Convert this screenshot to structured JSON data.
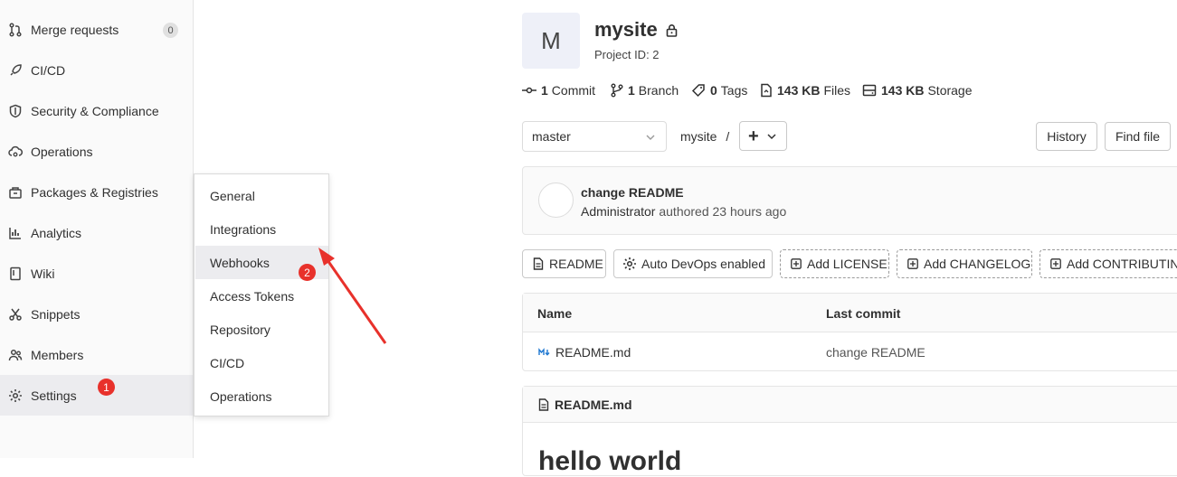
{
  "sidebar": {
    "items": [
      {
        "label": "Merge requests",
        "icon": "merge-request-icon",
        "badge": "0"
      },
      {
        "label": "CI/CD",
        "icon": "rocket-icon"
      },
      {
        "label": "Security & Compliance",
        "icon": "shield-icon"
      },
      {
        "label": "Operations",
        "icon": "cloud-gear-icon"
      },
      {
        "label": "Packages & Registries",
        "icon": "package-icon"
      },
      {
        "label": "Analytics",
        "icon": "chart-icon"
      },
      {
        "label": "Wiki",
        "icon": "book-icon"
      },
      {
        "label": "Snippets",
        "icon": "scissors-icon"
      },
      {
        "label": "Members",
        "icon": "users-icon"
      },
      {
        "label": "Settings",
        "icon": "gear-icon"
      }
    ],
    "step_marker": "1"
  },
  "flyout": {
    "items": [
      "General",
      "Integrations",
      "Webhooks",
      "Access Tokens",
      "Repository",
      "CI/CD",
      "Operations"
    ],
    "step_marker": "2"
  },
  "project": {
    "avatar_letter": "M",
    "name": "mysite",
    "id_label": "Project ID: 2"
  },
  "stats": [
    {
      "value": "1",
      "label": "Commit",
      "icon": "commit-icon"
    },
    {
      "value": "1",
      "label": "Branch",
      "icon": "branch-icon"
    },
    {
      "value": "0",
      "label": "Tags",
      "icon": "tag-icon"
    },
    {
      "value": "143 KB",
      "label": "Files",
      "icon": "file-icon"
    },
    {
      "value": "143 KB",
      "label": "Storage",
      "icon": "storage-icon"
    }
  ],
  "toolbar": {
    "branch": "master",
    "path": "mysite",
    "path_sep": "/",
    "add_symbol": "+",
    "history": "History",
    "find_file": "Find file"
  },
  "last_commit": {
    "title": "change README",
    "author": "Administrator",
    "meta": "authored 23 hours ago"
  },
  "actions": {
    "readme": "README",
    "autodevops": "Auto DevOps enabled",
    "license": "Add LICENSE",
    "changelog": "Add CHANGELOG",
    "contributing": "Add CONTRIBUTING"
  },
  "files_table": {
    "headers": [
      "Name",
      "Last commit"
    ],
    "rows": [
      {
        "name": "README.md",
        "commit": "change README"
      }
    ]
  },
  "readme": {
    "filename": "README.md",
    "heading": "hello world"
  },
  "colors": {
    "step_marker": "#e8312b",
    "arrow": "#e8312b"
  }
}
